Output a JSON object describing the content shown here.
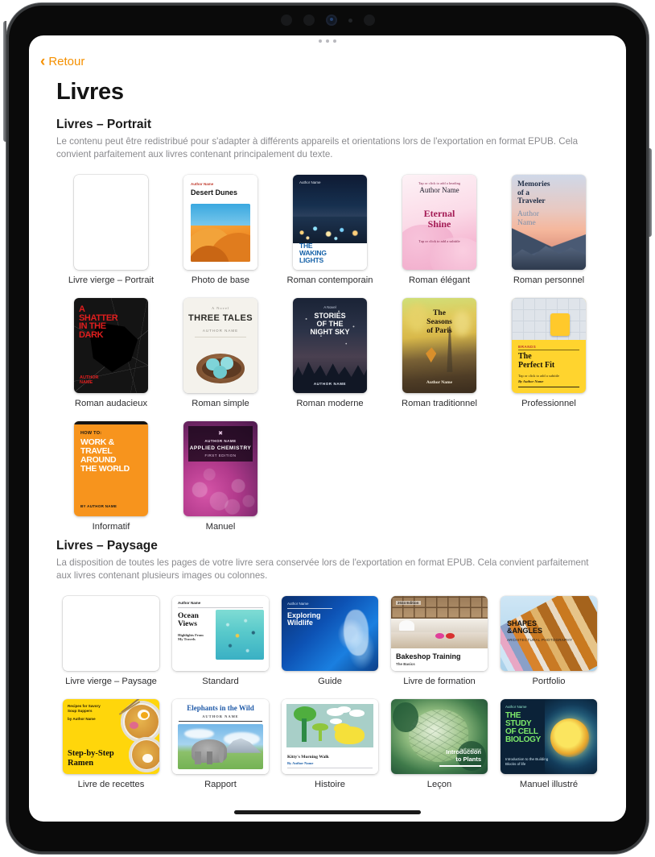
{
  "device": {
    "camera_icons": [
      "camera-dot",
      "camera-dot",
      "camera-lens",
      "sensor-dot",
      "camera-dot"
    ]
  },
  "nav": {
    "back_label": "Retour",
    "back_icon": "chevron-left-icon"
  },
  "page": {
    "title": "Livres"
  },
  "sections": [
    {
      "id": "portrait",
      "title": "Livres – Portrait",
      "description": "Le contenu peut être redistribué pour s'adapter à différents appareils et orientations lors de l'exportation en format EPUB. Cela convient parfaitement aux livres contenant principalement du texte.",
      "items": [
        {
          "label": "Livre vierge – Portrait",
          "blank": true,
          "cover": {}
        },
        {
          "label": "Photo de base",
          "cover": {
            "author": "Author Name",
            "title": "Desert Dunes"
          }
        },
        {
          "label": "Roman contemporain",
          "cover": {
            "author": "Author Name",
            "title": "THE WAKING LIGHTS"
          }
        },
        {
          "label": "Roman élégant",
          "cover": {
            "heading_hint": "Tap or click to add a heading",
            "author": "Author Name",
            "title": "Eternal Shine",
            "subtitle_hint": "Tap or click to add a subtitle"
          }
        },
        {
          "label": "Roman personnel",
          "cover": {
            "title": "Memories of a Traveler",
            "author": "Author Name"
          }
        },
        {
          "label": "Roman audacieux",
          "cover": {
            "title": "A SHATTER IN THE DARK",
            "author": "AUTHOR NAME"
          }
        },
        {
          "label": "Roman simple",
          "cover": {
            "kicker": "A Novel",
            "title": "THREE TALES",
            "author": "AUTHOR NAME"
          }
        },
        {
          "label": "Roman moderne",
          "cover": {
            "kicker": "A Novel",
            "title": "STORIES OF THE NIGHT SKY",
            "author": "AUTHOR NAME"
          }
        },
        {
          "label": "Roman traditionnel",
          "cover": {
            "title": "The Seasons of Paris",
            "author": "Author Name"
          }
        },
        {
          "label": "Professionnel",
          "cover": {
            "kicker": "BRANDS",
            "title": "The Perfect Fit",
            "subtitle_hint": "Tap or click to add a subtitle",
            "author": "By Author Name"
          }
        },
        {
          "label": "Informatif",
          "cover": {
            "kicker": "HOW TO:",
            "title": "WORK & TRAVEL AROUND THE WORLD",
            "author": "BY AUTHOR NAME"
          }
        },
        {
          "label": "Manuel",
          "cover": {
            "author": "AUTHOR NAME",
            "title": "APPLIED CHEMISTRY",
            "edition": "FIRST EDITION"
          }
        }
      ]
    },
    {
      "id": "landscape",
      "title": "Livres – Paysage",
      "description": "La disposition de toutes les pages de votre livre sera conservée lors de l'exportation en format EPUB. Cela convient parfaitement aux livres contenant plusieurs images ou colonnes.",
      "items": [
        {
          "label": "Livre vierge – Paysage",
          "blank": true,
          "cover": {}
        },
        {
          "label": "Standard",
          "cover": {
            "author": "Author Name",
            "title": "Ocean Views",
            "subtitle": "Highlights From My Travels"
          }
        },
        {
          "label": "Guide",
          "cover": {
            "author": "Author Name",
            "title": "Exploring Wildlife"
          }
        },
        {
          "label": "Livre de formation",
          "cover": {
            "kicker": "2024 Edition",
            "title": "Bakeshop Training",
            "subtitle": "The Basics"
          }
        },
        {
          "label": "Portfolio",
          "cover": {
            "title": "SHAPES & ANGLES",
            "subtitle": "ARCHITECTURAL PHOTOGRAPHY"
          }
        },
        {
          "label": "Livre de recettes",
          "cover": {
            "kicker": "Recipes for Savory Soup Suppers",
            "author": "by Author Name",
            "title": "Step-by-Step Ramen"
          }
        },
        {
          "label": "Rapport",
          "cover": {
            "title": "Elephants in the Wild",
            "author": "AUTHOR NAME"
          }
        },
        {
          "label": "Histoire",
          "cover": {
            "title": "Kitty's Morning Walk",
            "author": "By Author Name"
          }
        },
        {
          "label": "Leçon",
          "cover": {
            "author": "Author Name",
            "title": "Introduction to Plants"
          }
        },
        {
          "label": "Manuel illustré",
          "cover": {
            "author": "Author Name",
            "title": "THE STUDY OF CELL BIOLOGY",
            "subtitle": "Introduction to the Building Blocks of life"
          }
        }
      ]
    }
  ],
  "colors": {
    "accent": "#f59000",
    "text_primary": "#141414",
    "text_secondary": "#8a8a8e",
    "background": "#ffffff"
  }
}
